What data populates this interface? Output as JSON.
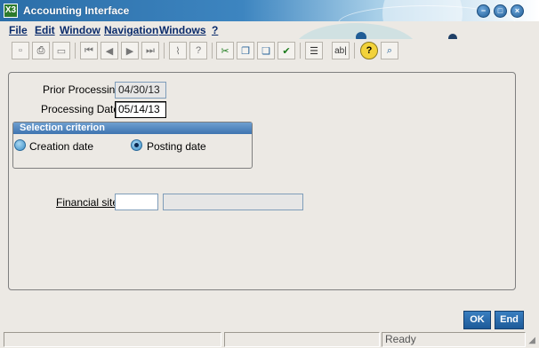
{
  "window": {
    "title": "Accounting Interface",
    "app_icon": "X3",
    "controls": {
      "minimize": "−",
      "maximize": "□",
      "close": "×"
    }
  },
  "menu": [
    {
      "label": "File"
    },
    {
      "label": "Edit"
    },
    {
      "label": "Window"
    },
    {
      "label": "Navigation"
    },
    {
      "label": "Windows"
    },
    {
      "label": "?"
    }
  ],
  "toolbar": {
    "icons": [
      "new-document-icon",
      "print-icon",
      "print-preview-icon",
      "first-record-icon",
      "previous-record-icon",
      "next-record-icon",
      "last-record-icon",
      "attachment-icon",
      "help-icon",
      "cut-icon",
      "copy-icon",
      "paste-icon",
      "validate-icon",
      "properties-icon",
      "text-field-icon",
      "help-question-icon",
      "search-help-icon"
    ],
    "glyphs": {
      "new": "▫",
      "print": "⎙",
      "preview": "▭",
      "first": "⏮",
      "prev": "◀",
      "next": "▶",
      "last": "⏭",
      "attach": "⌇",
      "help": "?",
      "cut": "✂",
      "copy": "❐",
      "paste": "❏",
      "validate": "✔",
      "props": "☰",
      "text": "ab|",
      "qhelp": "?",
      "search": "⌕"
    }
  },
  "form": {
    "prior_processing_label": "Prior Processing",
    "prior_processing_value": "04/30/13",
    "processing_date_label": "Processing Date",
    "processing_date_value": "05/14/13",
    "selection_criterion_title": "Selection criterion",
    "options": [
      {
        "label": "Creation date",
        "selected": false
      },
      {
        "label": "Posting date",
        "selected": true
      }
    ],
    "financial_site_label": "Financial site",
    "financial_site_value": "",
    "financial_site_description": ""
  },
  "buttons": {
    "ok": "OK",
    "end": "End"
  },
  "status": {
    "ready": "Ready"
  },
  "colors": {
    "title_bar": "#2b6ea8",
    "menu_text": "#0a2b6b",
    "button_blue": "#1d5a99",
    "group_header": "#3e74b0"
  }
}
